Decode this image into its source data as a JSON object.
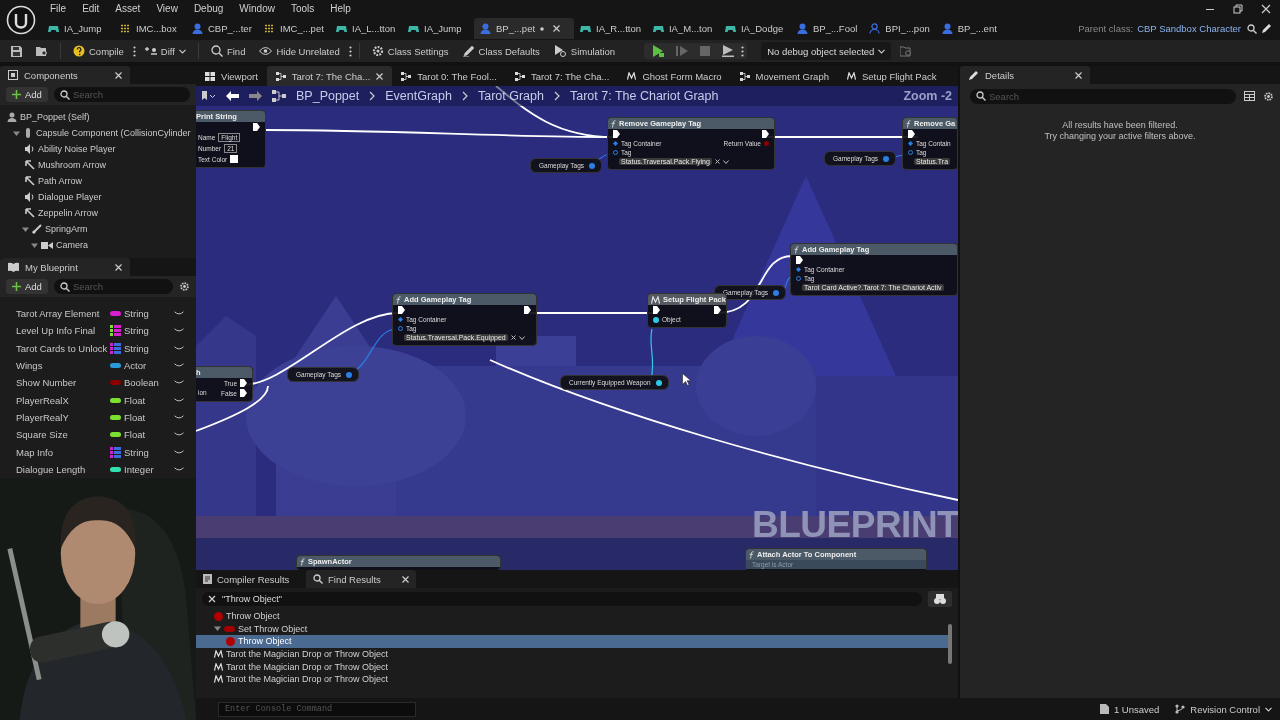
{
  "menu": [
    "File",
    "Edit",
    "Asset",
    "View",
    "Debug",
    "Window",
    "Tools",
    "Help"
  ],
  "asset_tabs": [
    {
      "label": "IA_Jump",
      "kind": "input_action",
      "selected": false,
      "modified": false
    },
    {
      "label": "IMC...box",
      "kind": "mapping",
      "selected": false,
      "modified": false
    },
    {
      "label": "CBP_...ter",
      "kind": "blueprint",
      "selected": false,
      "modified": false
    },
    {
      "label": "IMC_...pet",
      "kind": "mapping",
      "selected": false,
      "modified": false
    },
    {
      "label": "IA_L...tton",
      "kind": "input_action",
      "selected": false,
      "modified": false
    },
    {
      "label": "IA_Jump",
      "kind": "input_action",
      "selected": false,
      "modified": false
    },
    {
      "label": "BP_...pet",
      "kind": "blueprint",
      "selected": true,
      "modified": true
    },
    {
      "label": "IA_R...tton",
      "kind": "input_action",
      "selected": false,
      "modified": false
    },
    {
      "label": "IA_M...ton",
      "kind": "input_action",
      "selected": false,
      "modified": false
    },
    {
      "label": "IA_Dodge",
      "kind": "input_action",
      "selected": false,
      "modified": false
    },
    {
      "label": "BP_...Fool",
      "kind": "blueprint",
      "selected": false,
      "modified": false
    },
    {
      "label": "BPI_...pon",
      "kind": "interface",
      "selected": false,
      "modified": false
    },
    {
      "label": "BP_...ent",
      "kind": "blueprint",
      "selected": false,
      "modified": false
    }
  ],
  "parent_class": {
    "label": "Parent class:",
    "value": "CBP Sandbox Character"
  },
  "toolbar": {
    "compile": "Compile",
    "diff": "Diff",
    "buttons": [
      "Find",
      "Hide Unrelated",
      "Class Settings",
      "Class Defaults",
      "Simulation"
    ],
    "debug_object": "No debug object selected"
  },
  "components": {
    "title": "Components",
    "add": "Add",
    "search_placeholder": "Search",
    "tree": [
      {
        "label": "BP_Poppet (Self)",
        "kind": "self",
        "children": [
          {
            "label": "Capsule Component (CollisionCylinder",
            "kind": "capsule",
            "expanded": true,
            "children": [
              {
                "label": "Ability Noise Player",
                "kind": "audio"
              },
              {
                "label": "Mushroom Arrow",
                "kind": "arrow"
              },
              {
                "label": "Path Arrow",
                "kind": "arrow"
              },
              {
                "label": "Dialogue Player",
                "kind": "audio"
              },
              {
                "label": "Zeppelin Arrow",
                "kind": "arrow"
              },
              {
                "label": "SpringArm",
                "kind": "springarm",
                "expanded": true,
                "children": [
                  {
                    "label": "Camera",
                    "kind": "camera",
                    "expanded": true
                  }
                ]
              }
            ]
          }
        ]
      }
    ]
  },
  "my_blueprint": {
    "title": "My Blueprint",
    "add": "Add",
    "search_placeholder": "Search",
    "variables": [
      {
        "name": "Tarot Array Element",
        "type": "String",
        "kind": "single",
        "color": "#d81fd0"
      },
      {
        "name": "Level Up Info Final",
        "type": "String",
        "kind": "map",
        "key": {
          "color": "#7ce030"
        },
        "color": "#d81fd0"
      },
      {
        "name": "Tarot Cards to Unlock",
        "type": "String",
        "kind": "map",
        "key": {
          "color": "#d81fd0"
        },
        "color": "#3a6ee0"
      },
      {
        "name": "Wings",
        "type": "Actor",
        "kind": "single",
        "color": "#2a9ad8"
      },
      {
        "name": "Show Number",
        "type": "Boolean",
        "kind": "single",
        "color": "#8a0000"
      },
      {
        "name": "PlayerRealX",
        "type": "Float",
        "kind": "single",
        "color": "#7ce030"
      },
      {
        "name": "PlayerRealY",
        "type": "Float",
        "kind": "single",
        "color": "#7ce030"
      },
      {
        "name": "Square Size",
        "type": "Float",
        "kind": "single",
        "color": "#7ce030"
      },
      {
        "name": "Map Info",
        "type": "String",
        "kind": "map",
        "key": {
          "color": "#d81fd0"
        },
        "color": "#3a6ee0"
      },
      {
        "name": "Dialogue Length",
        "type": "Integer",
        "kind": "single",
        "color": "#30e0b0"
      }
    ]
  },
  "doc_tabs": [
    {
      "label": "Viewport",
      "kind": "viewport",
      "selected": false
    },
    {
      "label": "Tarot 7: The Cha...",
      "kind": "graph",
      "selected": true
    },
    {
      "label": "Tarot 0: The Fool...",
      "kind": "graph",
      "selected": false
    },
    {
      "label": "Tarot 7: The Cha...",
      "kind": "graph",
      "selected": false
    },
    {
      "label": "Ghost Form Macro",
      "kind": "macro",
      "selected": false
    },
    {
      "label": "Movement Graph",
      "kind": "graph",
      "selected": false
    },
    {
      "label": "Setup Flight Pack",
      "kind": "macro",
      "selected": false
    }
  ],
  "graph": {
    "breadcrumb": [
      "BP_Poppet",
      "EventGraph",
      "Tarot Graph",
      "Tarot 7: The Chariot Graph"
    ],
    "zoom": "Zoom -2",
    "watermark": "BLUEPRINT",
    "nodes": [
      {
        "kind": "cut",
        "title": "Print String",
        "rows": [
          {
            "right": {
              "kind": "exec"
            }
          },
          {
            "left": {
              "kind": "field",
              "label": "Name",
              "value": "Flight"
            }
          },
          {
            "left": {
              "kind": "field",
              "label": "Number",
              "value": "21"
            }
          },
          {
            "left": {
              "kind": "swatch",
              "label": "Text Color"
            }
          }
        ]
      },
      {
        "kind": "function",
        "title": "Remove Gameplay Tag",
        "rows": [
          {
            "left": {
              "kind": "exec"
            },
            "right": {
              "kind": "exec"
            }
          },
          {
            "left": {
              "kind": "container",
              "label": "Tag Container"
            },
            "right": {
              "kind": "return",
              "label": "Return Value"
            }
          },
          {
            "left": {
              "kind": "tag",
              "label": "Tag",
              "value": "Status.Traversal.Pack.Flying",
              "removable": true
            }
          }
        ]
      },
      {
        "kind": "variable",
        "title": "Gameplay Tags",
        "color": "#2a7fe0"
      },
      {
        "kind": "variable",
        "title": "Gameplay Tags",
        "color": "#2a7fe0"
      },
      {
        "kind": "function",
        "title": "Remove Ga",
        "rows": [
          {
            "left": {
              "kind": "exec"
            }
          },
          {
            "left": {
              "kind": "container",
              "label": "Tag Contain"
            }
          },
          {
            "left": {
              "kind": "tag",
              "label": "Tag",
              "value": "Status.Tra",
              "removable": false
            }
          }
        ]
      },
      {
        "kind": "function",
        "title": "Add Gameplay Tag",
        "rows": [
          {
            "left": {
              "kind": "exec"
            }
          },
          {
            "left": {
              "kind": "container",
              "label": "Tag Container"
            }
          },
          {
            "left": {
              "kind": "tag",
              "label": "Tag",
              "value": "Tarot Card Active?.Tarot 7: The Chariot Activ",
              "removable": false
            }
          }
        ]
      },
      {
        "kind": "variable",
        "title": "Gameplay Tags",
        "color": "#2a7fe0"
      },
      {
        "kind": "function",
        "title": "Add Gameplay Tag",
        "rows": [
          {
            "left": {
              "kind": "exec"
            },
            "right": {
              "kind": "exec"
            }
          },
          {
            "left": {
              "kind": "container",
              "label": "Tag Container"
            }
          },
          {
            "left": {
              "kind": "tag",
              "label": "Tag",
              "value": "Status.Traversal.Pack.Equipped",
              "removable": true
            }
          }
        ]
      },
      {
        "kind": "macro",
        "title": "Setup Flight Pack",
        "rows": [
          {
            "left": {
              "kind": "exec"
            },
            "right": {
              "kind": "exec"
            }
          },
          {
            "left": {
              "kind": "object",
              "label": "Object"
            }
          }
        ]
      },
      {
        "kind": "cut",
        "title": "h",
        "rows": [
          {
            "right": {
              "kind": "exec",
              "label": "True"
            }
          },
          {
            "left": {
              "kind": "label",
              "label": "ion"
            },
            "right": {
              "kind": "exec",
              "label": "False"
            }
          }
        ]
      },
      {
        "kind": "variable",
        "title": "Gameplay Tags",
        "color": "#2a7fe0"
      },
      {
        "kind": "variable",
        "title": "Currently Equipped Weapon",
        "color": "#2ec8e8"
      },
      {
        "kind": "function",
        "title": "SpawnActor"
      },
      {
        "kind": "function",
        "title": "Attach Actor To Component",
        "subtitle": "Target is Actor"
      }
    ]
  },
  "find": {
    "tabs": [
      {
        "label": "Compiler Results",
        "kind": "compiler",
        "selected": false
      },
      {
        "label": "Find Results",
        "kind": "find",
        "selected": true
      }
    ],
    "query": "\"Throw Object\"",
    "results": [
      {
        "label": "Throw Object",
        "kind": "variable",
        "selected": false
      },
      {
        "label": "Set Throw Object",
        "kind": "setter",
        "selected": false,
        "expanded": true,
        "children": [
          {
            "label": "Throw Object",
            "kind": "variable",
            "selected": true
          }
        ]
      },
      {
        "label": "Tarot the Magician Drop or Throw Object",
        "kind": "macro",
        "selected": false
      },
      {
        "label": "Tarot the Magician Drop or Throw Object",
        "kind": "macro",
        "selected": false
      },
      {
        "label": "Tarot the Magician Drop or Throw Object",
        "kind": "macro",
        "selected": false
      }
    ]
  },
  "details": {
    "title": "Details",
    "search_placeholder": "Search",
    "message": [
      "All results have been filtered.",
      "Try changing your active filters above."
    ]
  },
  "status_bar": {
    "console_placeholder": "Enter Console Command",
    "unsaved": "1 Unsaved",
    "revision": "Revision Control"
  }
}
